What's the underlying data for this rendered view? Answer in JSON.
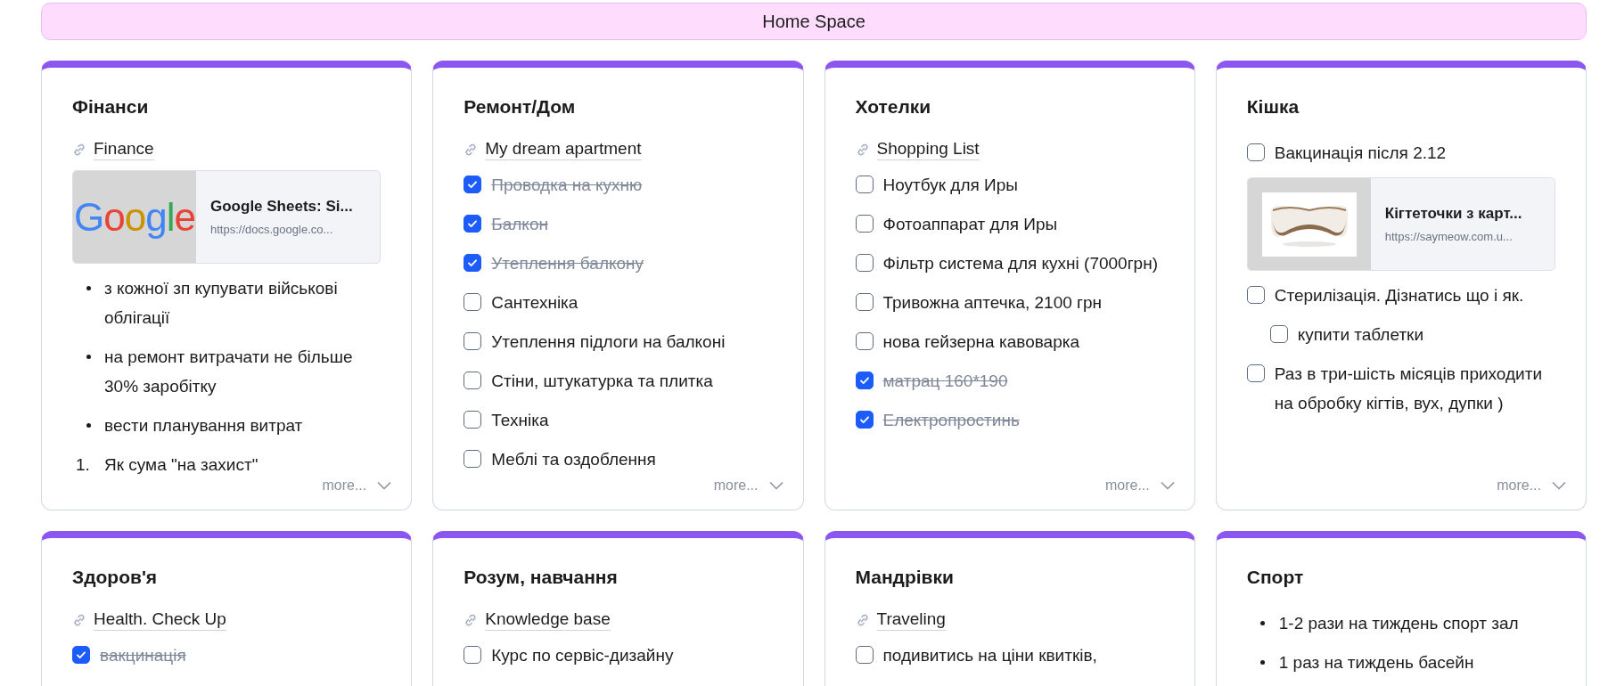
{
  "header": {
    "title": "Home Space"
  },
  "cards": [
    {
      "title": "Фінанси",
      "more": "more...",
      "blocks": [
        {
          "kind": "link",
          "text": "Finance"
        },
        {
          "kind": "preview",
          "thumbnail": {
            "kind": "logo",
            "text": "Google"
          },
          "title": "Google Sheets: Si...",
          "url": "https://docs.google.co..."
        },
        {
          "kind": "bullet",
          "text": "з кожної зп купувати військові облігації"
        },
        {
          "kind": "bullet",
          "text": "на ремонт витрачати не більше 30% заробітку"
        },
        {
          "kind": "bullet",
          "text": "вести планування витрат"
        },
        {
          "kind": "numbered",
          "number": "1.",
          "text": "Як сума \"на захист\""
        }
      ]
    },
    {
      "title": "Ремонт/Дом",
      "more": "more...",
      "blocks": [
        {
          "kind": "link",
          "text": "My dream apartment"
        },
        {
          "kind": "check",
          "text": "Проводка на кухню",
          "checked": true
        },
        {
          "kind": "check",
          "text": "Балкон",
          "checked": true
        },
        {
          "kind": "check",
          "text": "Утеплення балкону",
          "checked": true
        },
        {
          "kind": "check",
          "text": "Сантехніка",
          "checked": false
        },
        {
          "kind": "check",
          "text": "Утеплення підлоги на балконі",
          "checked": false
        },
        {
          "kind": "check",
          "text": "Стіни, штукатурка та плитка",
          "checked": false
        },
        {
          "kind": "check",
          "text": "Техніка",
          "checked": false
        },
        {
          "kind": "check",
          "text": "Меблі та оздоблення",
          "checked": false
        }
      ]
    },
    {
      "title": "Хотелки",
      "more": "more...",
      "blocks": [
        {
          "kind": "link",
          "text": "Shopping List"
        },
        {
          "kind": "check",
          "text": "Ноутбук для Иры",
          "checked": false
        },
        {
          "kind": "check",
          "text": "Фотоаппарат для Иры",
          "checked": false
        },
        {
          "kind": "check",
          "text": "Фільтр система для кухні (7000грн)",
          "checked": false
        },
        {
          "kind": "check",
          "text": "Тривожна аптечка, 2100 грн",
          "checked": false
        },
        {
          "kind": "check",
          "text": "нова гейзерна кавоварка",
          "checked": false
        },
        {
          "kind": "check",
          "text": "матрац 160*190",
          "checked": true
        },
        {
          "kind": "check",
          "text": "Електропростинь",
          "checked": true
        }
      ]
    },
    {
      "title": "Кішка",
      "more": "more...",
      "blocks": [
        {
          "kind": "check",
          "text": "Вакцинація після 2.12",
          "checked": false
        },
        {
          "kind": "preview",
          "title": "Кігтеточки з карт...",
          "url": "https://saymeow.com.u..."
        },
        {
          "kind": "check",
          "text": "Стерилізація. Дізнатись що і як.",
          "checked": false,
          "children": [
            {
              "kind": "check",
              "text": "купити таблетки",
              "checked": false
            }
          ]
        },
        {
          "kind": "check",
          "text": "Раз в три-шість місяців приходити на обробку кігтів, вух, дупки )",
          "checked": false
        }
      ]
    },
    {
      "title": "Здоров'я",
      "blocks": [
        {
          "kind": "link",
          "text": "Health. Check Up"
        },
        {
          "kind": "check",
          "text": "вакцинація",
          "checked": true
        }
      ]
    },
    {
      "title": "Розум, навчання",
      "blocks": [
        {
          "kind": "link",
          "text": "Knowledge base"
        },
        {
          "kind": "check",
          "text": "Курс по сервіс-дизайну",
          "checked": false
        }
      ]
    },
    {
      "title": "Мандрівки",
      "blocks": [
        {
          "kind": "link",
          "text": "Traveling"
        },
        {
          "kind": "check",
          "text": "подивитись на ціни квитків,",
          "checked": false
        }
      ]
    },
    {
      "title": "Спорт",
      "blocks": [
        {
          "kind": "bullet",
          "text": "1-2 рази на тиждень спорт зал"
        },
        {
          "kind": "bullet",
          "text": "1 раз на тиждень басейн"
        }
      ]
    }
  ]
}
